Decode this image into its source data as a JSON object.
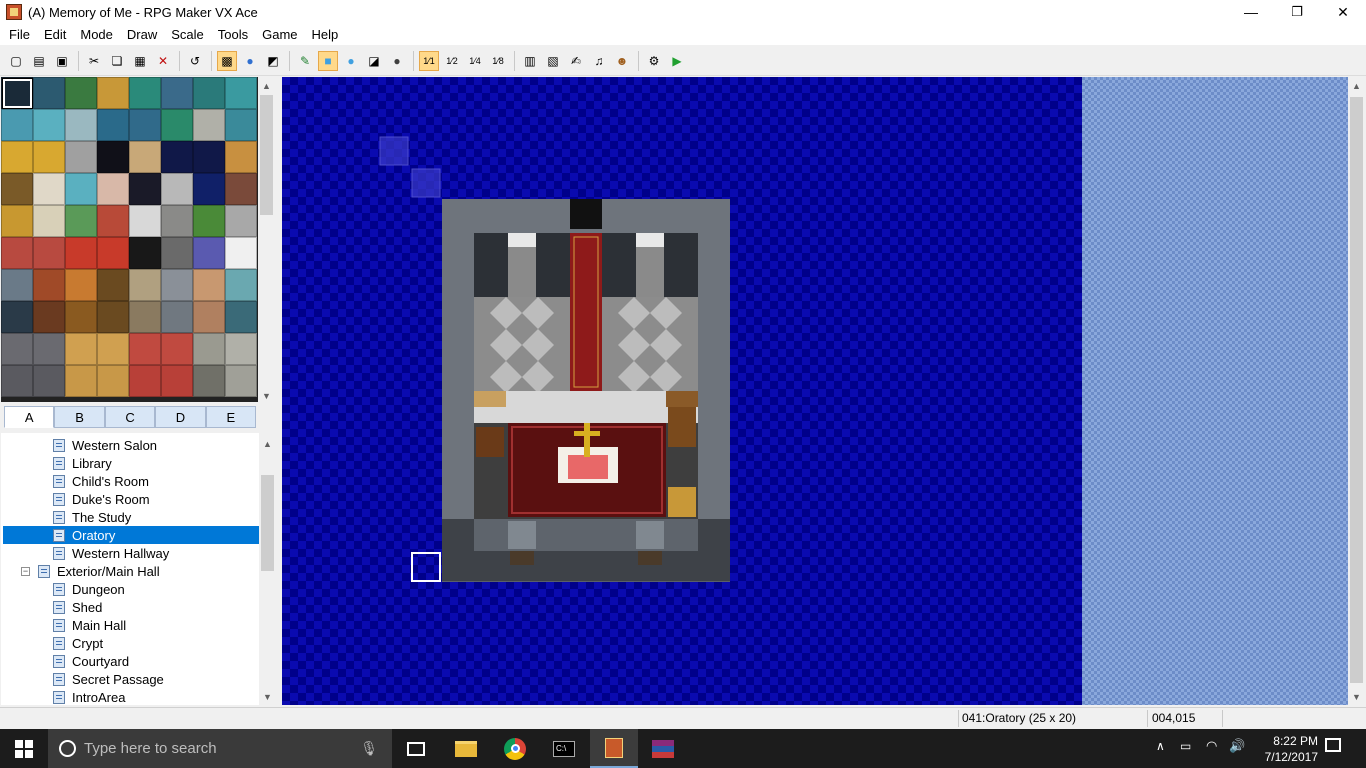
{
  "window": {
    "title": "(A) Memory of Me - RPG Maker VX Ace",
    "minimize": "—",
    "restore": "❐",
    "close": "✕"
  },
  "menu": [
    "File",
    "Edit",
    "Mode",
    "Draw",
    "Scale",
    "Tools",
    "Game",
    "Help"
  ],
  "toolbar": {
    "groups": [
      [
        {
          "icon": "new-project-icon",
          "glyph": "▢"
        },
        {
          "icon": "open-project-icon",
          "glyph": "▤"
        },
        {
          "icon": "save-project-icon",
          "glyph": "▣"
        }
      ],
      [
        {
          "icon": "cut-icon",
          "glyph": "✂"
        },
        {
          "icon": "copy-icon",
          "glyph": "❏"
        },
        {
          "icon": "paste-icon",
          "glyph": "▦"
        },
        {
          "icon": "delete-icon",
          "glyph": "✕",
          "color": "#c01010"
        }
      ],
      [
        {
          "icon": "undo-icon",
          "glyph": "↺"
        }
      ],
      [
        {
          "icon": "map-mode-icon",
          "glyph": "▩",
          "active": true
        },
        {
          "icon": "event-mode-icon",
          "glyph": "●",
          "color": "#3070d0"
        },
        {
          "icon": "region-mode-icon",
          "glyph": "◩"
        }
      ],
      [
        {
          "icon": "pencil-icon",
          "glyph": "✎",
          "color": "#208030"
        },
        {
          "icon": "rectangle-icon",
          "glyph": "■",
          "active": true,
          "color": "#40a0e0"
        },
        {
          "icon": "ellipse-icon",
          "glyph": "●",
          "color": "#40a0e0"
        },
        {
          "icon": "fill-icon",
          "glyph": "◪"
        },
        {
          "icon": "shadow-pen-icon",
          "glyph": "●",
          "color": "#404040"
        }
      ],
      [
        {
          "icon": "scale-1-1-icon",
          "glyph": "1⁄1",
          "active": true
        },
        {
          "icon": "scale-1-2-icon",
          "glyph": "1⁄2"
        },
        {
          "icon": "scale-1-4-icon",
          "glyph": "1⁄4"
        },
        {
          "icon": "scale-1-8-icon",
          "glyph": "1⁄8"
        }
      ],
      [
        {
          "icon": "database-icon",
          "glyph": "▥"
        },
        {
          "icon": "resource-manager-icon",
          "glyph": "▧"
        },
        {
          "icon": "script-editor-icon",
          "glyph": "✍"
        },
        {
          "icon": "sound-test-icon",
          "glyph": "♫"
        },
        {
          "icon": "character-generator-icon",
          "glyph": "☻",
          "color": "#a06020"
        }
      ],
      [
        {
          "icon": "options-icon",
          "glyph": "⚙"
        },
        {
          "icon": "playtest-icon",
          "glyph": "▶",
          "color": "#20a030"
        }
      ]
    ]
  },
  "tileset": {
    "tabs": [
      "A",
      "B",
      "C",
      "D",
      "E"
    ],
    "active_tab": "A"
  },
  "map_tree": {
    "items": [
      {
        "label": "Western Salon",
        "depth": 2
      },
      {
        "label": "Library",
        "depth": 2
      },
      {
        "label": "Child's Room",
        "depth": 2
      },
      {
        "label": "Duke's Room",
        "depth": 2
      },
      {
        "label": "The Study",
        "depth": 2
      },
      {
        "label": "Oratory",
        "depth": 2,
        "selected": true
      },
      {
        "label": "Western Hallway",
        "depth": 2
      },
      {
        "label": "Exterior/Main Hall",
        "depth": 1,
        "expanded": true
      },
      {
        "label": "Dungeon",
        "depth": 2
      },
      {
        "label": "Shed",
        "depth": 2
      },
      {
        "label": "Main Hall",
        "depth": 2
      },
      {
        "label": "Crypt",
        "depth": 2
      },
      {
        "label": "Courtyard",
        "depth": 2
      },
      {
        "label": "Secret Passage",
        "depth": 2
      },
      {
        "label": "IntroArea",
        "depth": 2
      }
    ],
    "expander": "−"
  },
  "statusbar": {
    "map": "041:Oratory (25 x 20)",
    "coords": "004,015"
  },
  "taskbar": {
    "search_placeholder": "Type here to search",
    "time": "8:22 PM",
    "date": "7/12/2017"
  },
  "colors": {
    "accent": "#0078d7",
    "map_void": "#0a0ab0",
    "taskbar": "#1c1c1c"
  }
}
